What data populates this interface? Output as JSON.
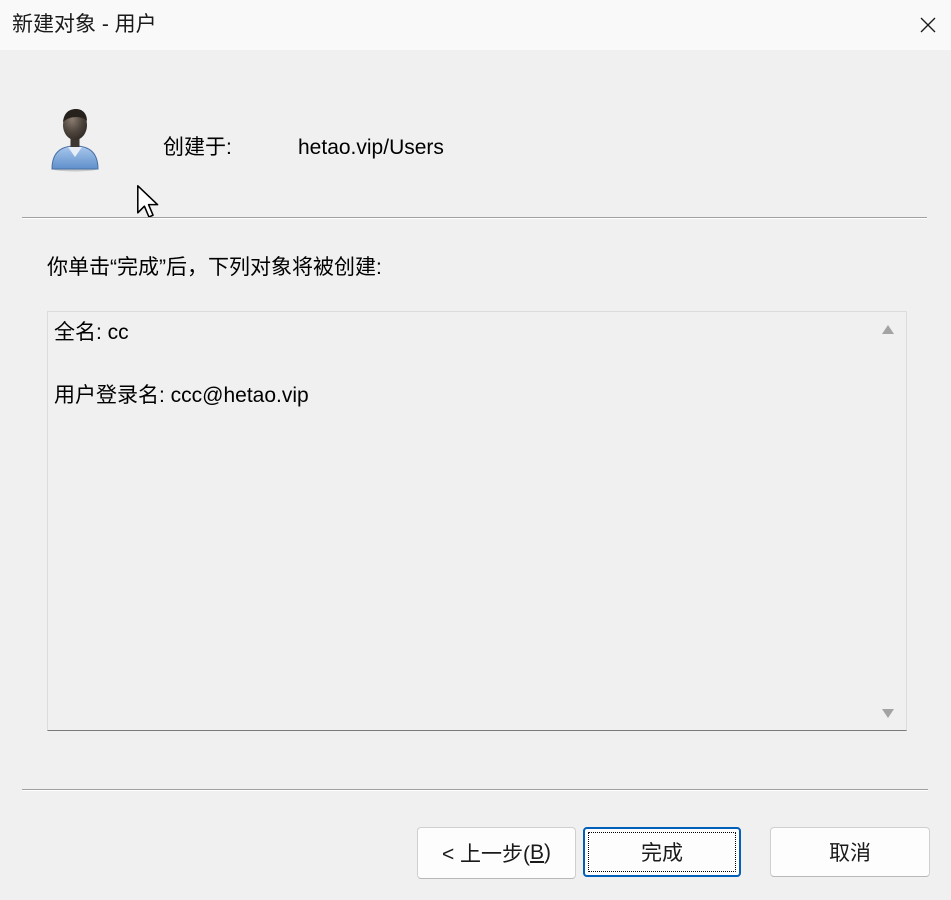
{
  "window": {
    "title": "新建对象 - 用户"
  },
  "header": {
    "created_in_label": "创建于:",
    "created_in_value": "hetao.vip/Users"
  },
  "instruction": "你单击“完成”后，下列对象将被创建:",
  "summary": {
    "full_name": "全名: cc",
    "logon_name": "用户登录名: ccc@hetao.vip"
  },
  "buttons": {
    "back": {
      "prefix": "< 上一步(",
      "accelerator": "B",
      "suffix": ")"
    },
    "finish": "完成",
    "cancel": "取消"
  },
  "icons": {
    "close": "close-icon",
    "user": "user-icon",
    "cursor": "mouse-cursor-icon",
    "scroll_up": "scroll-up-arrow-icon",
    "scroll_down": "scroll-down-arrow-icon"
  },
  "theme": {
    "dialog_background": "#f0f0f0",
    "titlebar_background": "#f9f9f9",
    "focus_accent": "#005fb8",
    "separator": "#a0a0a0",
    "scroll_arrow": "#a3a3a3"
  }
}
